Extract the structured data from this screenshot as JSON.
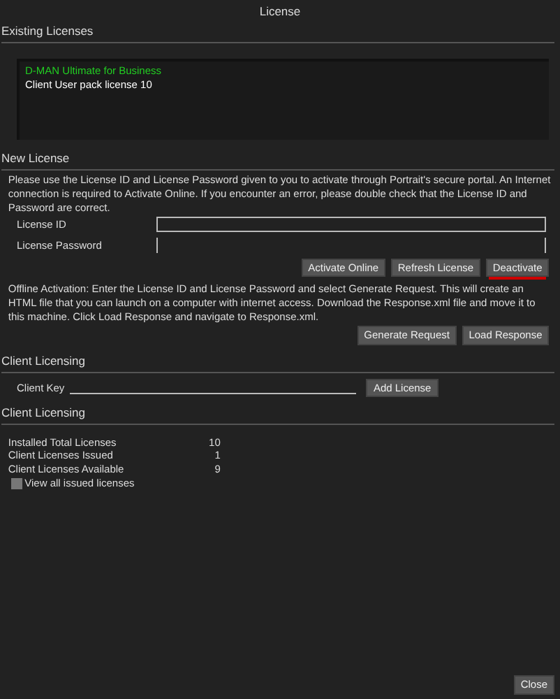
{
  "window": {
    "title": "License"
  },
  "existing": {
    "heading": "Existing Licenses",
    "items": [
      {
        "label": "D-MAN Ultimate for Business",
        "color": "#22cc22"
      },
      {
        "label": "Client User pack license 10",
        "color": "#ffffff"
      }
    ]
  },
  "new_license": {
    "heading": "New License",
    "intro": "Please use the License ID and License Password given to you to activate through Portrait's secure portal.  An Internet connection is required to Activate Online.  If you encounter an error, please double check that the License ID and Password are correct.",
    "fields": [
      {
        "label": "License ID",
        "kind": "box"
      },
      {
        "label": "License Password",
        "kind": "sides"
      }
    ],
    "buttons": [
      {
        "label": "Activate Online",
        "underlined": false
      },
      {
        "label": "Refresh License",
        "underlined": false
      },
      {
        "label": "Deactivate",
        "underlined": true
      }
    ],
    "offline": "Offline Activation:  Enter the License ID and License Password and select Generate Request.  This will create an HTML file that you can launch on a computer with internet access.  Download the Response.xml file and move it to this machine.  Click Load Response and navigate to Response.xml.",
    "offline_buttons": [
      "Generate Request",
      "Load Response"
    ]
  },
  "client_key": {
    "heading": "Client Licensing",
    "label": "Client Key",
    "button": "Add License"
  },
  "client_stats": {
    "heading": "Client Licensing",
    "rows": [
      {
        "label": "Installed Total Licenses",
        "value": "10"
      },
      {
        "label": "Client Licenses Issued",
        "value": "1"
      },
      {
        "label": "Client Licenses Available",
        "value": "9"
      }
    ],
    "checkbox": {
      "label": "View all issued licenses",
      "checked": false
    }
  },
  "footer": {
    "button": "Close"
  }
}
